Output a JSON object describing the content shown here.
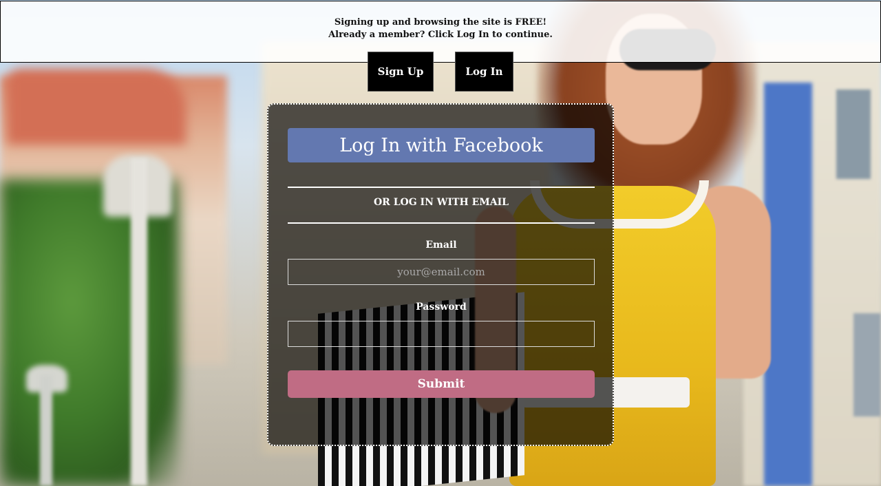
{
  "banner": {
    "line1": "Signing up and browsing the site is FREE!",
    "line2": "Already a member? Click Log In to continue."
  },
  "nav": {
    "signup_label": "Sign Up",
    "login_label": "Log In"
  },
  "login_form": {
    "facebook_label": "Log In with Facebook",
    "divider_text": "OR LOG IN WITH EMAIL",
    "email_label": "Email",
    "email_placeholder": "your@email.com",
    "email_value": "",
    "password_label": "Password",
    "password_value": "",
    "submit_label": "Submit"
  },
  "colors": {
    "facebook_button": "#6378b0",
    "submit_button": "#c06c84",
    "card_background": "rgba(0,0,0,0.66)",
    "nav_button": "#000000"
  }
}
